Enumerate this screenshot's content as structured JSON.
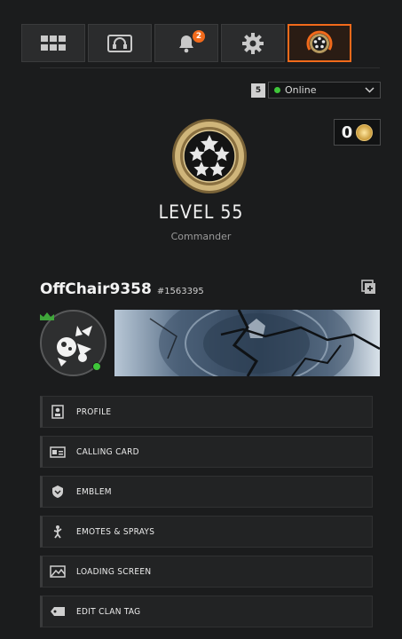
{
  "topbar": {
    "tabs": [
      {
        "icon": "grid-icon"
      },
      {
        "icon": "headset-icon"
      },
      {
        "icon": "bell-icon",
        "badge": "2"
      },
      {
        "icon": "gear-icon"
      },
      {
        "icon": "player-emblem-icon",
        "active": true
      }
    ]
  },
  "status": {
    "party_count": "5",
    "value": "Online",
    "color": "#3fc63a"
  },
  "currency": {
    "value": "0",
    "icon": "cod-points-coin-icon"
  },
  "profile": {
    "level": "LEVEL 55",
    "rank": "Commander"
  },
  "player": {
    "gamertag": "OffChair9358",
    "id": "#1563395"
  },
  "menu": {
    "items": [
      {
        "label": "PROFILE",
        "icon": "profile-icon"
      },
      {
        "label": "CALLING CARD",
        "icon": "calling-card-icon"
      },
      {
        "label": "EMBLEM",
        "icon": "emblem-icon"
      },
      {
        "label": "EMOTES & SPRAYS",
        "icon": "emote-icon"
      },
      {
        "label": "LOADING SCREEN",
        "icon": "loading-screen-icon"
      },
      {
        "label": "EDIT CLAN TAG",
        "icon": "clan-tag-icon"
      }
    ]
  },
  "colors": {
    "accent": "#f26a1b",
    "online": "#3fc63a",
    "background": "#1b1c1d"
  }
}
